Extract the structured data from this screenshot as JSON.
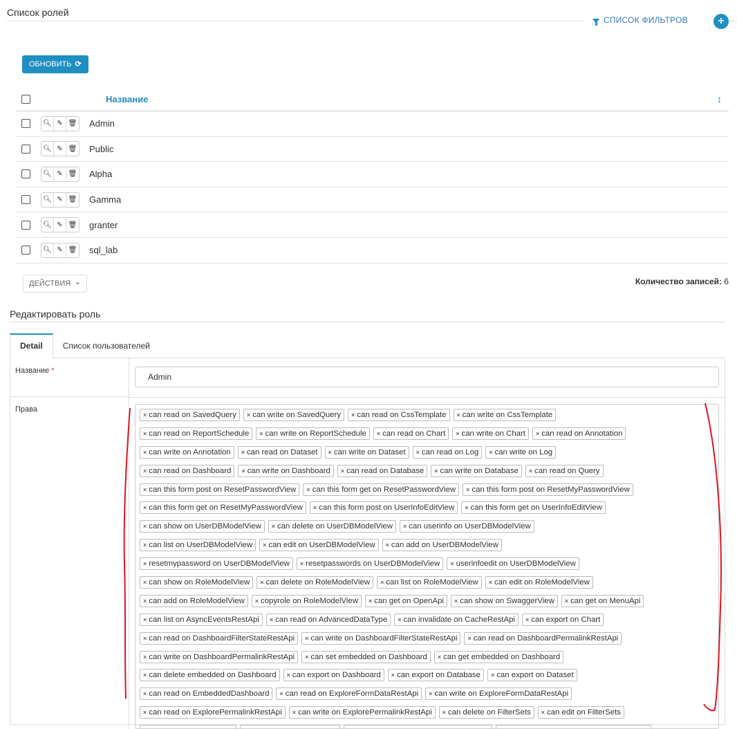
{
  "roles_list": {
    "title": "Список ролей",
    "filters_label": "СПИСОК ФИЛЬТРОВ",
    "refresh_label": "ОБНОВИТЬ",
    "column_name": "Название",
    "rows": [
      "Admin",
      "Public",
      "Alpha",
      "Gamma",
      "granter",
      "sql_lab"
    ],
    "actions_label": "ДЕЙСТВИЯ",
    "record_count_label": "Количество записей:",
    "record_count": "6"
  },
  "edit_role": {
    "title": "Редактировать роль",
    "tabs": [
      "Detail",
      "Список пользователей"
    ],
    "name_label": "Название",
    "required_mark": "*",
    "name_value": "Admin",
    "rights_label": "Права",
    "permission_lines": [
      [
        "can read on SavedQuery",
        "can write on SavedQuery",
        "can read on CssTemplate",
        "can write on CssTemplate"
      ],
      [
        "can read on ReportSchedule",
        "can write on ReportSchedule",
        "can read on Chart",
        "can write on Chart",
        "can read on Annotation"
      ],
      [
        "can write on Annotation",
        "can read on Dataset",
        "can write on Dataset",
        "can read on Log",
        "can write on Log"
      ],
      [
        "can read on Dashboard",
        "can write on Dashboard",
        "can read on Database",
        "can write on Database",
        "can read on Query"
      ],
      [
        "can this form post on ResetPasswordView",
        "can this form get on ResetPasswordView",
        "can this form post on ResetMyPasswordView"
      ],
      [
        "can this form get on ResetMyPasswordView",
        "can this form post on UserInfoEditView",
        "can this form get on UserInfoEditView"
      ],
      [
        "can show on UserDBModelView",
        "can delete on UserDBModelView",
        "can userinfo on UserDBModelView"
      ],
      [
        "can list on UserDBModelView",
        "can edit on UserDBModelView",
        "can add on UserDBModelView"
      ],
      [
        "resetmypassword on UserDBModelView",
        "resetpasswords on UserDBModelView",
        "userinfoedit on UserDBModelView"
      ],
      [
        "can show on RoleModelView",
        "can delete on RoleModelView",
        "can list on RoleModelView",
        "can edit on RoleModelView"
      ],
      [
        "can add on RoleModelView",
        "copyrole on RoleModelView",
        "can get on OpenApi",
        "can show on SwaggerView",
        "can get on MenuApi"
      ],
      [
        "can list on AsyncEventsRestApi",
        "can read on AdvancedDataType",
        "can invalidate on CacheRestApi",
        "can export on Chart"
      ],
      [
        "can read on DashboardFilterStateRestApi",
        "can write on DashboardFilterStateRestApi",
        "can read on DashboardPermalinkRestApi"
      ],
      [
        "can write on DashboardPermalinkRestApi",
        "can set embedded on Dashboard",
        "can get embedded on Dashboard"
      ],
      [
        "can delete embedded on Dashboard",
        "can export on Dashboard",
        "can export on Database",
        "can export on Dataset"
      ],
      [
        "can read on EmbeddedDashboard",
        "can read on ExploreFormDataRestApi",
        "can write on ExploreFormDataRestApi"
      ],
      [
        "can read on ExplorePermalinkRestApi",
        "can write on ExplorePermalinkRestApi",
        "can delete on FilterSets",
        "can edit on FilterSets"
      ],
      [
        "",
        "",
        "",
        ""
      ]
    ]
  },
  "icons": {
    "remove": "×",
    "refresh": "⟳",
    "caret": "⌄",
    "sort": "↕",
    "search": "🔍︎",
    "edit": "✎",
    "trash": "🗑︎",
    "plus": "+"
  },
  "colors": {
    "accent": "#1f8fc2",
    "annotation": "#e0141e"
  }
}
